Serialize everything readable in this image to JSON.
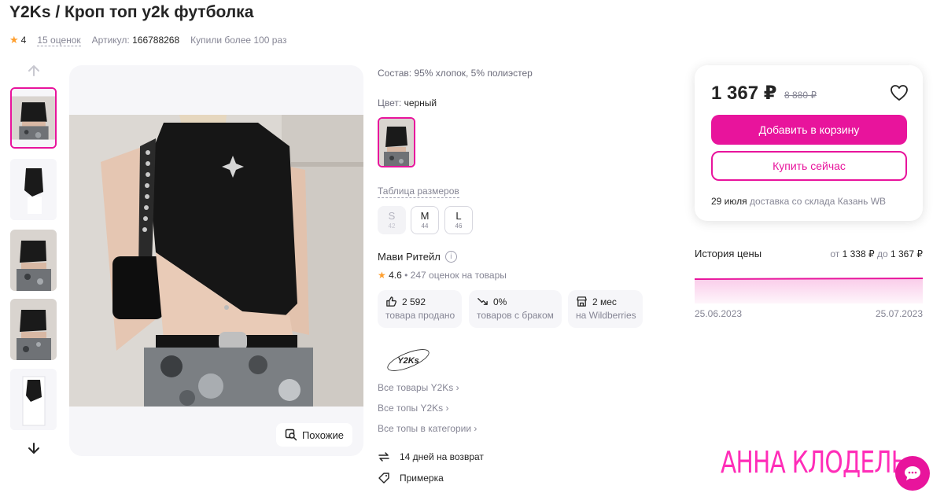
{
  "product": {
    "title": "Y2Ks / Кроп топ y2k футболка",
    "rating": "4",
    "reviews": "15 оценок",
    "article_label": "Артикул:",
    "article_value": "166788268",
    "bought": "Купили более 100 раз"
  },
  "gallery": {
    "similar_label": "Похожие"
  },
  "details": {
    "composition": "Состав: 95% хлопок, 5% полиэстер",
    "color_label": "Цвет:",
    "color_value": "черный",
    "size_table_label": "Таблица размеров",
    "sizes": [
      {
        "label": "S",
        "num": "42",
        "available": false
      },
      {
        "label": "M",
        "num": "44",
        "available": true
      },
      {
        "label": "L",
        "num": "46",
        "available": true
      }
    ]
  },
  "seller": {
    "name": "Мави Ритейл",
    "rating": "4.6",
    "ratings_count": "• 247 оценок на товары",
    "stats": [
      {
        "icon": "thumbs-up-icon",
        "value": "2 592",
        "label": "товара продано"
      },
      {
        "icon": "trend-down-icon",
        "value": "0%",
        "label": "товаров с браком"
      },
      {
        "icon": "store-icon",
        "value": "2 мес",
        "label": "на Wildberries"
      }
    ]
  },
  "brand": {
    "logo_text": "Y2Ks",
    "links": [
      "Все товары Y2Ks",
      "Все топы Y2Ks",
      "Все топы в категории"
    ]
  },
  "services": {
    "return": "14 дней на возврат",
    "fitting": "Примерка"
  },
  "price_card": {
    "price": "1 367 ₽",
    "old_price": "8 880 ₽",
    "add_to_cart": "Добавить в корзину",
    "buy_now": "Купить сейчас",
    "delivery_date": "29 июля",
    "delivery_text": "доставка со склада Казань WB"
  },
  "price_history": {
    "title": "История цены",
    "range_from_label": "от",
    "range_from": "1 338 ₽",
    "range_to_label": "до",
    "range_to": "1 367 ₽",
    "start_date": "25.06.2023",
    "end_date": "25.07.2023"
  },
  "watermark": "АННА КЛОДЕЛЬ",
  "colors": {
    "accent": "#e8149c",
    "star": "#ff9f2e",
    "watermark": "#ff2db8"
  }
}
